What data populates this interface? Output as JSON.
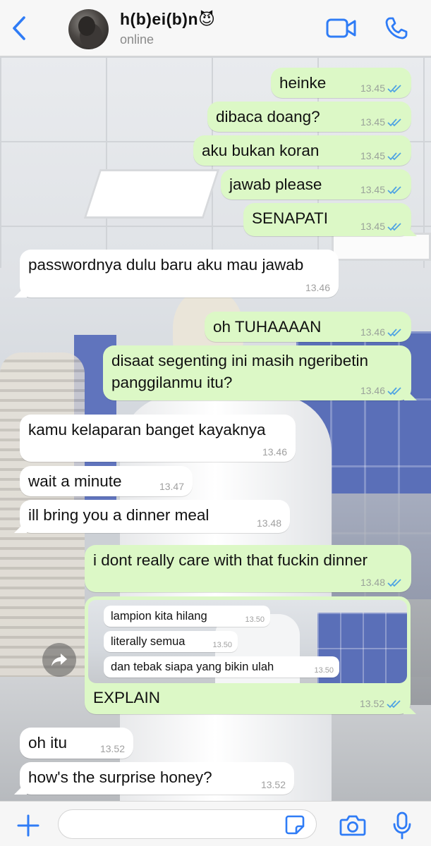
{
  "header": {
    "contact_name": "h(b)ei(b)n😈",
    "status": "online",
    "icons": {
      "back": "chevron-left-icon",
      "video": "video-camera-icon",
      "call": "phone-icon"
    }
  },
  "colors": {
    "accent": "#2f7cf6",
    "outgoing_bubble": "#dcf8c6",
    "incoming_bubble": "#ffffff",
    "read_ticks": "#4fa3e3"
  },
  "messages": [
    {
      "dir": "out",
      "text": "heinke",
      "time": "13.45",
      "read": true
    },
    {
      "dir": "out",
      "text": "dibaca doang?",
      "time": "13.45",
      "read": true
    },
    {
      "dir": "out",
      "text": "aku bukan koran",
      "time": "13.45",
      "read": true
    },
    {
      "dir": "out",
      "text": "jawab please",
      "time": "13.45",
      "read": true
    },
    {
      "dir": "out",
      "text": "SENAPATI",
      "time": "13.45",
      "read": true
    },
    {
      "dir": "in",
      "text": "passwordnya dulu baru aku mau jawab",
      "time": "13.46"
    },
    {
      "dir": "out",
      "text": "oh TUHAAAAN",
      "time": "13.46",
      "read": true
    },
    {
      "dir": "out",
      "text": "disaat segenting ini masih ngeribetin",
      "text2": "panggilanmu itu?",
      "time": "13.46",
      "read": true
    },
    {
      "dir": "in",
      "text": "kamu kelaparan banget kayaknya",
      "time": "13.46"
    },
    {
      "dir": "in",
      "text": "wait a minute",
      "time": "13.47"
    },
    {
      "dir": "in",
      "text": "ill bring you a dinner meal",
      "time": "13.48"
    },
    {
      "dir": "out",
      "text": "i dont really care with that fuckin dinner",
      "time": "13.48",
      "read": true
    },
    {
      "dir": "in",
      "text": "oh itu",
      "time": "13.52"
    },
    {
      "dir": "in",
      "text": "how's the surprise honey?",
      "time": "13.52"
    }
  ],
  "image_message": {
    "quoted": [
      {
        "text": "lampion kita hilang",
        "time": "13.50"
      },
      {
        "text": "literally semua",
        "time": "13.50"
      },
      {
        "text": "dan tebak siapa yang bikin ulah",
        "time": "13.50"
      }
    ],
    "caption": "EXPLAIN",
    "time": "13.52",
    "read": true
  },
  "input": {
    "value": "",
    "placeholder": ""
  },
  "input_icons": {
    "plus": "plus-icon",
    "sticker": "sticker-icon",
    "camera": "camera-icon",
    "mic": "microphone-icon"
  }
}
